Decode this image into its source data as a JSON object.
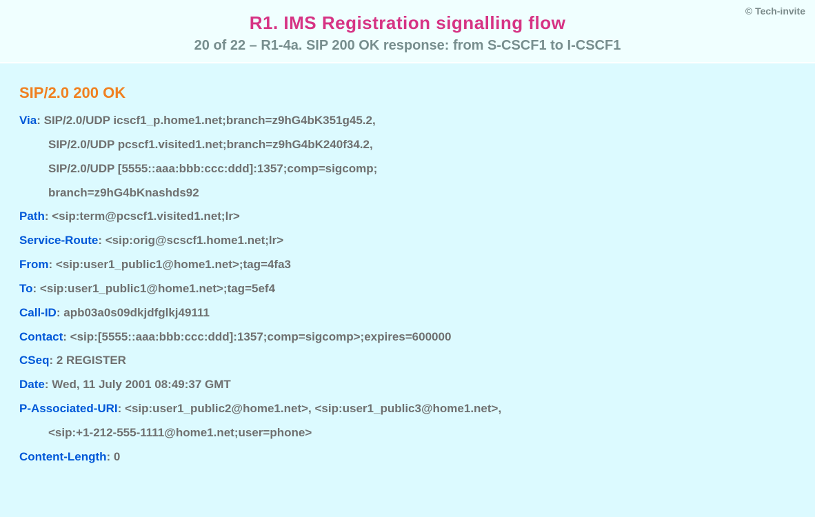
{
  "copyright": "© Tech-invite",
  "title": "R1. IMS Registration signalling flow",
  "subtitle": "20 of 22 – R1-4a. SIP 200 OK response: from S-CSCF1 to I-CSCF1",
  "statusLine": "SIP/2.0 200 OK",
  "headers": {
    "via": {
      "name": "Via",
      "lines": [
        "SIP/2.0/UDP icscf1_p.home1.net;branch=z9hG4bK351g45.2,",
        "SIP/2.0/UDP pcscf1.visited1.net;branch=z9hG4bK240f34.2,",
        "SIP/2.0/UDP [5555::aaa:bbb:ccc:ddd]:1357;comp=sigcomp;",
        "branch=z9hG4bKnashds92"
      ]
    },
    "path": {
      "name": "Path",
      "value": "<sip:term@pcscf1.visited1.net;lr>"
    },
    "serviceRoute": {
      "name": "Service-Route",
      "value": "<sip:orig@scscf1.home1.net;lr>"
    },
    "from": {
      "name": "From",
      "value": "<sip:user1_public1@home1.net>;tag=4fa3"
    },
    "to": {
      "name": "To",
      "value": "<sip:user1_public1@home1.net>;tag=5ef4"
    },
    "callId": {
      "name": "Call-ID",
      "value": "apb03a0s09dkjdfglkj49111"
    },
    "contact": {
      "name": "Contact",
      "value": "<sip:[5555::aaa:bbb:ccc:ddd]:1357;comp=sigcomp>;expires=600000"
    },
    "cseq": {
      "name": "CSeq",
      "value": "2 REGISTER"
    },
    "date": {
      "name": "Date",
      "value": "Wed, 11 July 2001 08:49:37 GMT"
    },
    "pAssociatedUri": {
      "name": "P-Associated-URI",
      "lines": [
        "<sip:user1_public2@home1.net>, <sip:user1_public3@home1.net>,",
        "<sip:+1-212-555-1111@home1.net;user=phone>"
      ]
    },
    "contentLength": {
      "name": "Content-Length",
      "value": "0"
    }
  }
}
